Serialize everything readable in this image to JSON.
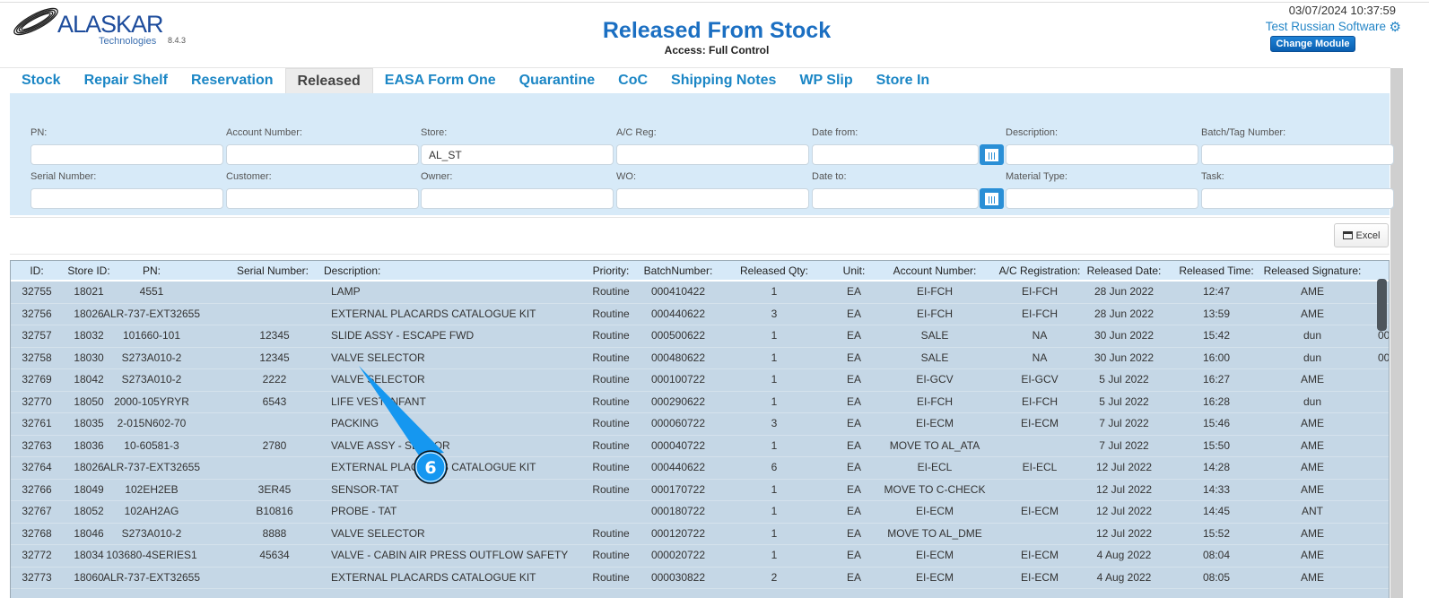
{
  "header": {
    "logo_text": "ALASKAR",
    "logo_sub": "Technologies",
    "version": "8.4.3",
    "title": "Released From Stock",
    "access": "Access: Full Control",
    "datetime": "03/07/2024 10:37:59",
    "user": "Test Russian Software",
    "change_module": "Change Module"
  },
  "tabs": [
    "Stock",
    "Repair Shelf",
    "Reservation",
    "Released",
    "EASA Form One",
    "Quarantine",
    "CoC",
    "Shipping Notes",
    "WP Slip",
    "Store In"
  ],
  "active_tab": "Released",
  "filters": {
    "row1": [
      {
        "label": "PN:",
        "value": ""
      },
      {
        "label": "Account Number:",
        "value": ""
      },
      {
        "label": "Store:",
        "value": "AL_ST"
      },
      {
        "label": "A/C Reg:",
        "value": ""
      },
      {
        "label": "Date from:",
        "value": ""
      },
      {
        "label": "Description:",
        "value": ""
      },
      {
        "label": "Batch/Tag Number:",
        "value": ""
      }
    ],
    "row2": [
      {
        "label": "Serial Number:",
        "value": ""
      },
      {
        "label": "Customer:",
        "value": ""
      },
      {
        "label": "Owner:",
        "value": ""
      },
      {
        "label": "WO:",
        "value": ""
      },
      {
        "label": "Date to:",
        "value": ""
      },
      {
        "label": "Material Type:",
        "value": ""
      },
      {
        "label": "Task:",
        "value": ""
      }
    ]
  },
  "excel_label": "Excel",
  "table": {
    "columns": [
      "ID:",
      "Store ID:",
      "PN:",
      "Serial Number:",
      "Description:",
      "Priority:",
      "BatchNumber:",
      "Released Qty:",
      "Unit:",
      "Account Number:",
      "A/C Registration:",
      "Released Date:",
      "Released Time:",
      "Released Signature:",
      ""
    ],
    "rows": [
      [
        "32755",
        "18021",
        "4551",
        "",
        "LAMP",
        "Routine",
        "000410422",
        "1",
        "EA",
        "EI-FCH",
        "EI-FCH",
        "28 Jun 2022",
        "12:47",
        "AME",
        ""
      ],
      [
        "32756",
        "18026",
        "ALR-737-EXT32655",
        "",
        "EXTERNAL PLACARDS CATALOGUE KIT",
        "Routine",
        "000440622",
        "3",
        "EA",
        "EI-FCH",
        "EI-FCH",
        "28 Jun 2022",
        "13:59",
        "AME",
        ""
      ],
      [
        "32757",
        "18032",
        "101660-101",
        "12345",
        "SLIDE ASSY - ESCAPE FWD",
        "Routine",
        "000500622",
        "1",
        "EA",
        "SALE",
        "NA",
        "30 Jun 2022",
        "15:42",
        "dun",
        "00"
      ],
      [
        "32758",
        "18030",
        "S273A010-2",
        "12345",
        "VALVE SELECTOR",
        "Routine",
        "000480622",
        "1",
        "EA",
        "SALE",
        "NA",
        "30 Jun 2022",
        "16:00",
        "dun",
        "00"
      ],
      [
        "32769",
        "18042",
        "S273A010-2",
        "2222",
        "VALVE SELECTOR",
        "Routine",
        "000100722",
        "1",
        "EA",
        "EI-GCV",
        "EI-GCV",
        "5 Jul 2022",
        "16:27",
        "AME",
        ""
      ],
      [
        "32770",
        "18050",
        "2000-105YRYR",
        "6543",
        "LIFE VEST INFANT",
        "Routine",
        "000290622",
        "1",
        "EA",
        "EI-FCH",
        "EI-FCH",
        "5 Jul 2022",
        "16:28",
        "dun",
        ""
      ],
      [
        "32761",
        "18035",
        "2-015N602-70",
        "",
        "PACKING",
        "Routine",
        "000060722",
        "3",
        "EA",
        "EI-ECM",
        "EI-ECM",
        "7 Jul 2022",
        "15:46",
        "AME",
        ""
      ],
      [
        "32763",
        "18036",
        "10-60581-3",
        "2780",
        "VALVE ASSY - SENSOR",
        "Routine",
        "000040722",
        "1",
        "EA",
        "MOVE TO AL_ATA",
        "",
        "7 Jul 2022",
        "15:50",
        "AME",
        ""
      ],
      [
        "32764",
        "18026",
        "ALR-737-EXT32655",
        "",
        "EXTERNAL PLACARDS CATALOGUE KIT",
        "Routine",
        "000440622",
        "6",
        "EA",
        "EI-ECL",
        "EI-ECL",
        "12 Jul 2022",
        "14:28",
        "AME",
        ""
      ],
      [
        "32766",
        "18049",
        "102EH2EB",
        "3ER45",
        "SENSOR-TAT",
        "Routine",
        "000170722",
        "1",
        "EA",
        "MOVE TO C-CHECK",
        "",
        "12 Jul 2022",
        "14:33",
        "AME",
        ""
      ],
      [
        "32767",
        "18052",
        "102AH2AG",
        "B10816",
        "PROBE - TAT",
        "",
        "000180722",
        "1",
        "EA",
        "EI-ECM",
        "EI-ECM",
        "12 Jul 2022",
        "14:45",
        "ANT",
        ""
      ],
      [
        "32768",
        "18046",
        "S273A010-2",
        "8888",
        "VALVE SELECTOR",
        "Routine",
        "000120722",
        "1",
        "EA",
        "MOVE TO AL_DME",
        "",
        "12 Jul 2022",
        "15:52",
        "AME",
        ""
      ],
      [
        "32772",
        "18034",
        "103680-4SERIES1",
        "45634",
        "VALVE - CABIN AIR PRESS OUTFLOW SAFETY",
        "Routine",
        "000020722",
        "1",
        "EA",
        "EI-ECM",
        "EI-ECM",
        "4 Aug 2022",
        "08:04",
        "AME",
        ""
      ],
      [
        "32773",
        "18060",
        "ALR-737-EXT32655",
        "",
        "EXTERNAL PLACARDS CATALOGUE KIT",
        "Routine",
        "000030822",
        "2",
        "EA",
        "EI-ECM",
        "EI-ECM",
        "4 Aug 2022",
        "08:05",
        "AME",
        ""
      ]
    ]
  },
  "annotation": {
    "label": "6",
    "color": "#1597f0"
  }
}
